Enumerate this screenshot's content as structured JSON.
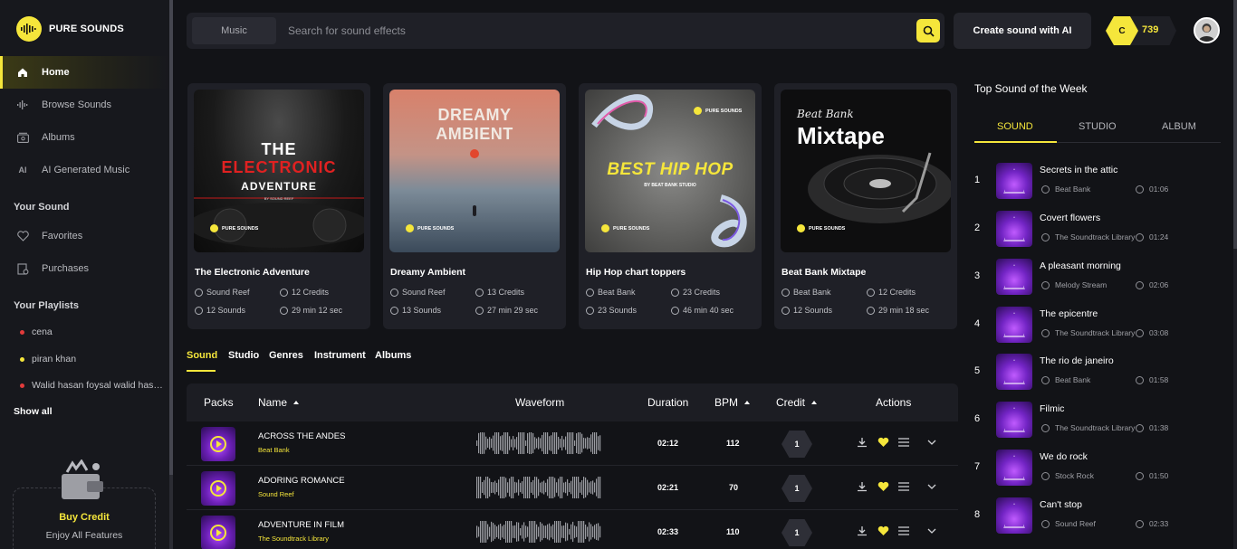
{
  "brand": {
    "name": "PURE SOUNDS",
    "accent": "#f5e63b",
    "background": "#121317"
  },
  "sidebar": {
    "nav": [
      {
        "label": "Home",
        "icon": "home-icon",
        "active": true
      },
      {
        "label": "Browse Sounds",
        "icon": "waveform-icon"
      },
      {
        "label": "Albums",
        "icon": "albums-icon"
      },
      {
        "label": "AI Generated Music",
        "icon": "ai-icon"
      }
    ],
    "your_sound_title": "Your Sound",
    "your_sound": [
      {
        "label": "Favorites",
        "icon": "heart-icon"
      },
      {
        "label": "Purchases",
        "icon": "purchases-icon"
      }
    ],
    "playlists_title": "Your Playlists",
    "playlists": [
      {
        "label": "cena",
        "color": "#e23b3b"
      },
      {
        "label": "piran khan",
        "color": "#f5e63b"
      },
      {
        "label": "Walid hasan foysal walid has…",
        "color": "#e23b3b"
      }
    ],
    "show_all": "Show all",
    "buy_credit": {
      "title": "Buy Credit",
      "subtitle": "Enjoy All Features"
    }
  },
  "topbar": {
    "category": "Music",
    "search_placeholder": "Search for sound effects",
    "create_button": "Create sound with AI",
    "credit_letter": "C",
    "credits": "739"
  },
  "cards": [
    {
      "title": "The Electronic Adventure",
      "artist": "Sound Reef",
      "credits": "12 Credits",
      "sounds": "12 Sounds",
      "length": "29 min 12 sec",
      "cover_line1": "THE",
      "cover_line2": "ELECTRONIC",
      "cover_line3": "ADVENTURE",
      "cover_small": "BY SOUND REEF",
      "badge": "PURE SOUNDS"
    },
    {
      "title": "Dreamy Ambient",
      "artist": "Sound Reef",
      "credits": "13 Credits",
      "sounds": "13 Sounds",
      "length": "27 min 29 sec",
      "cover_line1": "DREAMY",
      "cover_line2": "AMBIENT",
      "badge": "PURE SOUNDS"
    },
    {
      "title": "Hip Hop chart toppers",
      "artist": "Beat Bank",
      "credits": "23 Credits",
      "sounds": "23 Sounds",
      "length": "46 min 40 sec",
      "cover_line1": "BEST HIP HOP",
      "cover_small": "BY BEAT BANK STUDIO",
      "badge": "PURE SOUNDS"
    },
    {
      "title": "Beat Bank Mixtape",
      "artist": "Beat Bank",
      "credits": "12 Credits",
      "sounds": "12 Sounds",
      "length": "29 min 18 sec",
      "cover_line1": "Beat Bank",
      "cover_line2": "Mixtape",
      "badge": "PURE SOUNDS"
    }
  ],
  "tabs": [
    "Sound",
    "Studio",
    "Genres",
    "Instrument",
    "Albums"
  ],
  "table": {
    "headers": {
      "packs": "Packs",
      "name": "Name",
      "waveform": "Waveform",
      "duration": "Duration",
      "bpm": "BPM",
      "credit": "Credit",
      "actions": "Actions"
    },
    "rows": [
      {
        "name": "ACROSS THE ANDES",
        "artist": "Beat Bank",
        "duration": "02:12",
        "bpm": "112",
        "credit": "1"
      },
      {
        "name": "ADORING ROMANCE",
        "artist": "Sound Reef",
        "duration": "02:21",
        "bpm": "70",
        "credit": "1"
      },
      {
        "name": "ADVENTURE IN FILM",
        "artist": "The Soundtrack Library",
        "duration": "02:33",
        "bpm": "110",
        "credit": "1"
      }
    ]
  },
  "top_week": {
    "title": "Top Sound of the Week",
    "tabs": [
      "SOUND",
      "STUDIO",
      "ALBUM"
    ],
    "items": [
      {
        "rank": "1",
        "name": "Secrets in the attic",
        "artist": "Beat Bank",
        "time": "01:06"
      },
      {
        "rank": "2",
        "name": "Covert flowers",
        "artist": "The Soundtrack Library",
        "time": "01:24"
      },
      {
        "rank": "3",
        "name": "A pleasant morning",
        "artist": "Melody Stream",
        "time": "02:06"
      },
      {
        "rank": "4",
        "name": "The epicentre",
        "artist": "The Soundtrack Library",
        "time": "03:08"
      },
      {
        "rank": "5",
        "name": "The rio de janeiro",
        "artist": "Beat Bank",
        "time": "01:58"
      },
      {
        "rank": "6",
        "name": "Filmic",
        "artist": "The Soundtrack Library",
        "time": "01:38"
      },
      {
        "rank": "7",
        "name": "We do rock",
        "artist": "Stock Rock",
        "time": "01:50"
      },
      {
        "rank": "8",
        "name": "Can't stop",
        "artist": "Sound Reef",
        "time": "02:33"
      }
    ]
  }
}
